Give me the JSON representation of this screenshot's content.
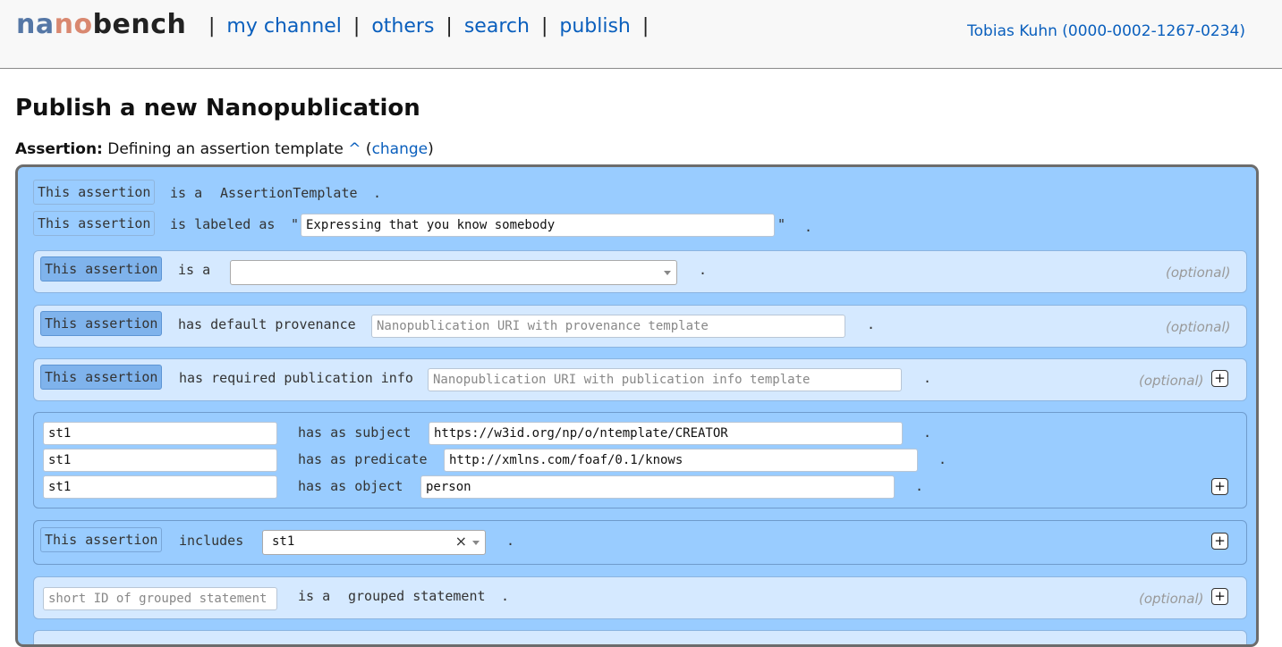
{
  "header": {
    "logo_part1": "na",
    "logo_part2": "no",
    "logo_part3": "bench",
    "nav": [
      "my channel",
      "others",
      "search",
      "publish"
    ],
    "separator": "|",
    "user": "Tobias Kuhn (0000-0002-1267-0234)"
  },
  "page": {
    "title": "Publish a new Nanopublication",
    "assertion_label": "Assertion:",
    "assertion_text": "Defining an assertion template",
    "caret": "^",
    "change_open": "(",
    "change_label": "change",
    "change_close": ")"
  },
  "rows": {
    "subject": "This assertion",
    "is_a": "is a",
    "assertion_template": "AssertionTemplate",
    "dot": ".",
    "labeled_as": "is labeled as",
    "quote": "\"",
    "label_value": "Expressing that you know somebody",
    "default_provenance": "has default provenance",
    "provenance_placeholder": "Nanopublication URI with provenance template",
    "required_pubinfo": "has required publication info",
    "pubinfo_placeholder": "Nanopublication URI with publication info template",
    "optional": "(optional)",
    "plus": "+"
  },
  "statement": {
    "id": "st1",
    "has_subject": "has as subject",
    "subject_value": "https://w3id.org/np/o/ntemplate/CREATOR",
    "has_predicate": "has as predicate",
    "predicate_value": "http://xmlns.com/foaf/0.1/knows",
    "has_object": "has as object",
    "object_value": "person"
  },
  "includes": {
    "label": "includes",
    "value": "st1",
    "clear": "×"
  },
  "grouped": {
    "placeholder": "short ID of grouped statement",
    "is_a": "is a",
    "type": "grouped statement"
  }
}
